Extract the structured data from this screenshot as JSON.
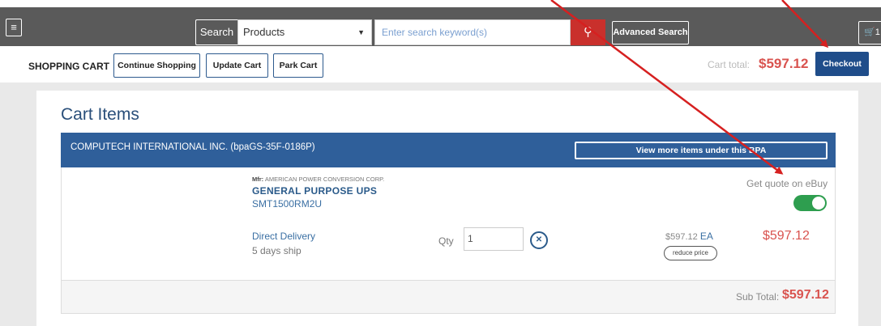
{
  "header": {
    "menu_icon": "hamburger-icon",
    "search_label": "Search",
    "search_scope": "Products",
    "search_placeholder": "Enter search keyword(s)",
    "search_icon": "search-icon",
    "advanced_search": "Advanced Search",
    "cart_icon": "cart-icon",
    "cart_count": "1"
  },
  "cart_bar": {
    "title": "SHOPPING CART",
    "continue_shopping": "Continue Shopping",
    "update_cart": "Update Cart",
    "park_cart": "Park Cart",
    "cart_total_label": "Cart total:",
    "cart_total_value": "$597.12",
    "checkout": "Checkout"
  },
  "cart": {
    "title": "Cart Items",
    "vendor": "COMPUTECH INTERNATIONAL INC. (bpaGS-35F-0186P)",
    "view_more": "View more items under this BPA",
    "item": {
      "mfr_label": "Mfr:",
      "mfr_name": "AMERICAN POWER CONVERSION CORP.",
      "name": "GENERAL PURPOSE UPS",
      "part_number": "SMT1500RM2U",
      "quote_label": "Get quote on eBuy",
      "quote_enabled": true,
      "delivery": "Direct Delivery",
      "ship_time": "5 days ship",
      "qty_label": "Qty",
      "qty_value": "1",
      "delete_icon": "trash-icon",
      "unit_price": "$597.12",
      "unit": "EA",
      "reduce_price": "reduce price",
      "line_total": "$597.12"
    },
    "subtotal_label": "Sub Total:",
    "subtotal_value": "$597.12"
  },
  "colors": {
    "topbar": "#5a5a5a",
    "accent_blue": "#2f5f9a",
    "price_red": "#d9534f",
    "toggle_green": "#2e9e4f",
    "annotation_arrow": "#d62020"
  }
}
